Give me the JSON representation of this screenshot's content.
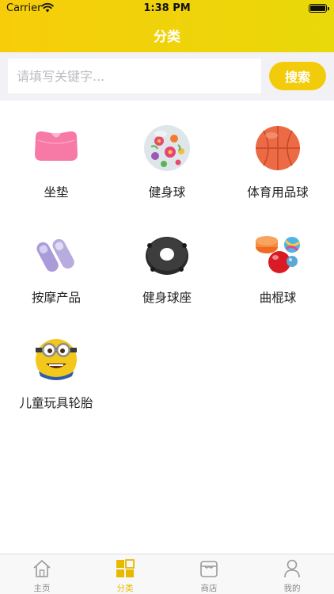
{
  "status_bar": {
    "carrier": "Carrier",
    "time": "1:38 PM"
  },
  "header": {
    "title": "分类"
  },
  "search": {
    "placeholder": "请填写关键字...",
    "button_label": "搜索"
  },
  "categories": [
    {
      "label": "坐垫",
      "icon": "cushion-icon"
    },
    {
      "label": "健身球",
      "icon": "floral-ball-icon"
    },
    {
      "label": "体育用品球",
      "icon": "basketball-icon"
    },
    {
      "label": "按摩产品",
      "icon": "massage-slippers-icon"
    },
    {
      "label": "健身球座",
      "icon": "ball-base-icon"
    },
    {
      "label": "曲棍球",
      "icon": "hockey-balls-icon"
    },
    {
      "label": "儿童玩具轮胎",
      "icon": "minion-toy-icon"
    }
  ],
  "tabbar": {
    "active_color": "#e9b800",
    "inactive_color": "#8a8a8a",
    "tabs": [
      {
        "label": "主页",
        "icon": "home-icon"
      },
      {
        "label": "分类",
        "icon": "category-grid-icon"
      },
      {
        "label": "商店",
        "icon": "store-icon"
      },
      {
        "label": "我的",
        "icon": "profile-icon"
      }
    ]
  }
}
